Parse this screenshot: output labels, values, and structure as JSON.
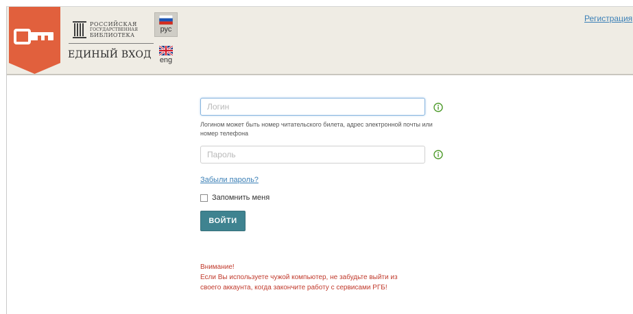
{
  "header": {
    "logo": {
      "line1": "РОССИЙСКАЯ",
      "line2": "ГОСУДАРСТВЕННАЯ",
      "line3": "БИБЛИОТЕКА",
      "title": "ЕДИНЫЙ ВХОД"
    },
    "languages": [
      {
        "label": "рус",
        "flag": "russia-flag-icon",
        "active": true
      },
      {
        "label": "eng",
        "flag": "uk-flag-icon",
        "active": false
      }
    ],
    "register_link": "Регистрация",
    "badge_icon": "key-icon",
    "badge_color": "#e1603d"
  },
  "form": {
    "login_placeholder": "Логин",
    "login_value": "",
    "login_hint": "Логином может быть номер читательского билета, адрес электронной почты или номер телефона",
    "password_placeholder": "Пароль",
    "password_value": "",
    "info_icon": "info-icon",
    "forgot_link": "Забыли пароль?",
    "remember_label": "Запомнить меня",
    "remember_checked": false,
    "submit_label": "ВОЙТИ"
  },
  "warning": {
    "title": "Внимание!",
    "line1": "Если Вы используете чужой компьютер, не забудьте выйти из",
    "line2": "своего аккаунта, когда закончите работу с сервисами РГБ!"
  },
  "colors": {
    "accent": "#3f8390",
    "link": "#3a7fb6",
    "warning": "#c0392b",
    "info_icon": "#4d9a2a",
    "header_bg": "#efece4"
  }
}
